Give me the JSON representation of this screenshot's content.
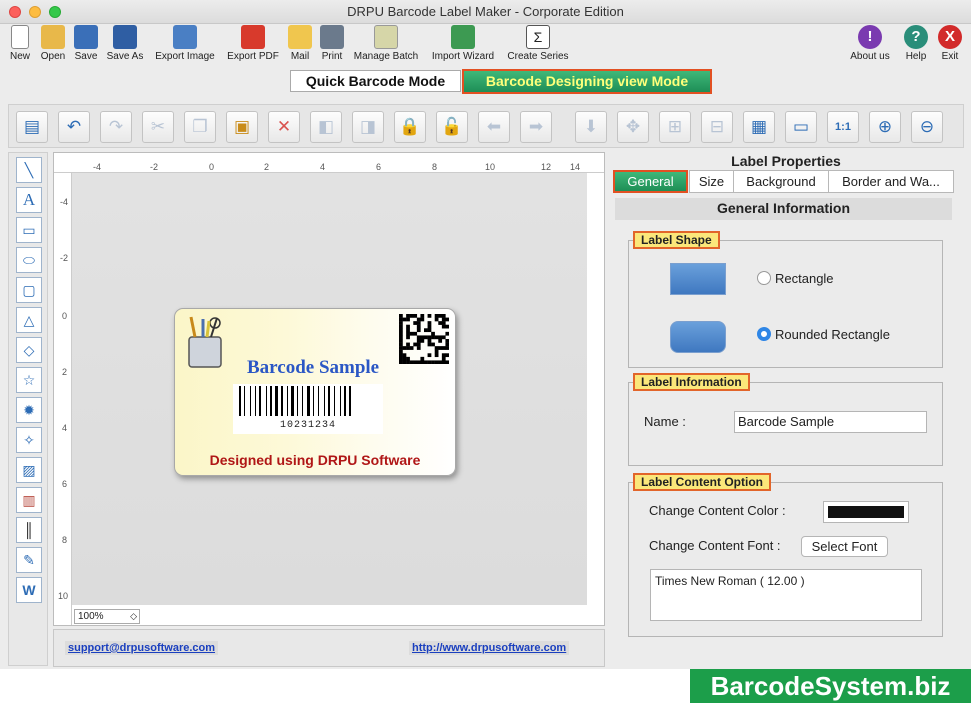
{
  "window": {
    "title": "DRPU Barcode Label Maker - Corporate Edition"
  },
  "toolbar": {
    "new": "New",
    "open": "Open",
    "save": "Save",
    "save_as": "Save As",
    "export_image": "Export Image",
    "export_pdf": "Export PDF",
    "mail": "Mail",
    "print": "Print",
    "manage_batch": "Manage Batch",
    "import_wizard": "Import Wizard",
    "create_series": "Create Series",
    "about": "About us",
    "help": "Help",
    "exit": "Exit"
  },
  "modes": {
    "quick": "Quick Barcode Mode",
    "designing": "Barcode Designing view Mode"
  },
  "ruler": {
    "top": [
      "-4",
      "-2",
      "0",
      "2",
      "4",
      "6",
      "8",
      "10",
      "12",
      "14"
    ],
    "left": [
      "-4",
      "-2",
      "0",
      "2",
      "4",
      "6",
      "8",
      "10"
    ]
  },
  "canvas": {
    "zoom": "100%"
  },
  "label": {
    "title": "Barcode Sample",
    "barcode_number": "10231234",
    "footer": "Designed using DRPU Software"
  },
  "status": {
    "email": "support@drpusoftware.com",
    "website": "http://www.drpusoftware.com"
  },
  "properties": {
    "title": "Label Properties",
    "tabs": [
      "General",
      "Size",
      "Background",
      "Border and Wa..."
    ],
    "section_title": "General Information",
    "label_shape": {
      "heading": "Label Shape",
      "rectangle": "Rectangle",
      "rounded": "Rounded Rectangle",
      "selected": "Rounded Rectangle"
    },
    "label_info": {
      "heading": "Label Information",
      "name_label": "Name :",
      "name_value": "Barcode Sample"
    },
    "content_option": {
      "heading": "Label Content Option",
      "color_label": "Change Content Color :",
      "color_value": "#111111",
      "font_label": "Change Content Font :",
      "font_button": "Select Font",
      "font_value": "Times New Roman ( 12.00 )"
    }
  },
  "brand": "BarcodeSystem.biz",
  "colors": {
    "accent_green": "#1e8e56",
    "highlight_border": "#e25022",
    "tag_yellow": "#fbe77a",
    "link_blue": "#1a3fbf"
  }
}
